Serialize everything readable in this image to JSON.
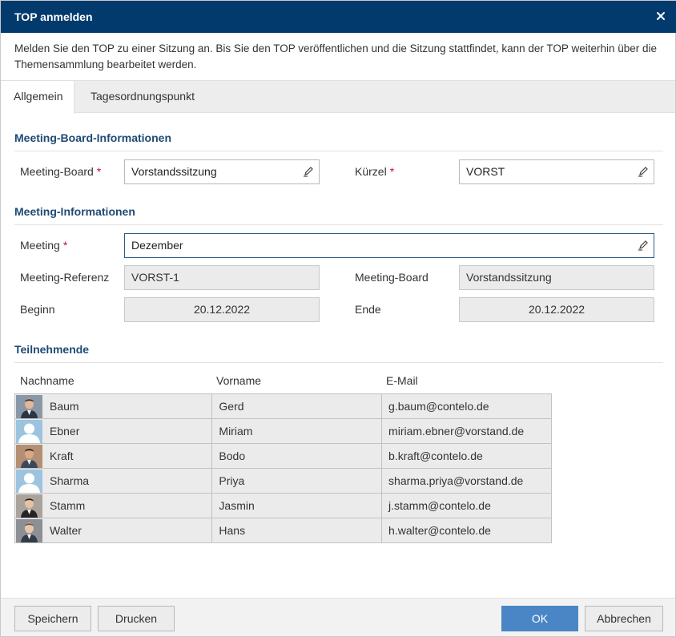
{
  "dialog": {
    "title": "TOP anmelden",
    "description": "Melden Sie den TOP zu einer Sitzung an. Bis Sie den TOP veröffentlichen und die Sitzung stattfindet, kann der TOP weiterhin über die Themensammlung bearbeitet werden."
  },
  "tabs": [
    {
      "label": "Allgemein",
      "active": true
    },
    {
      "label": "Tagesordnungspunkt",
      "active": false
    }
  ],
  "board_section": {
    "title": "Meeting-Board-Informationen",
    "board_label": "Meeting-Board",
    "board_value": "Vorstandssitzung",
    "short_label": "Kürzel",
    "short_value": "VORST",
    "required_mark": "*"
  },
  "meeting_section": {
    "title": "Meeting-Informationen",
    "meeting_label": "Meeting",
    "meeting_value": "Dezember",
    "reference_label": "Meeting-Referenz",
    "reference_value": "VORST-1",
    "board_label": "Meeting-Board",
    "board_value": "Vorstandssitzung",
    "start_label": "Beginn",
    "start_value": "20.12.2022",
    "end_label": "Ende",
    "end_value": "20.12.2022",
    "required_mark": "*"
  },
  "participants": {
    "title": "Teilnehmende",
    "columns": [
      "Nachname",
      "Vorname",
      "E-Mail"
    ],
    "rows": [
      {
        "last": "Baum",
        "first": "Gerd",
        "email": "g.baum@contelo.de",
        "avatar": "photo"
      },
      {
        "last": "Ebner",
        "first": "Miriam",
        "email": "miriam.ebner@vorstand.de",
        "avatar": "placeholder"
      },
      {
        "last": "Kraft",
        "first": "Bodo",
        "email": "b.kraft@contelo.de",
        "avatar": "photo"
      },
      {
        "last": "Sharma",
        "first": "Priya",
        "email": "sharma.priya@vorstand.de",
        "avatar": "placeholder"
      },
      {
        "last": "Stamm",
        "first": "Jasmin",
        "email": "j.stamm@contelo.de",
        "avatar": "photo"
      },
      {
        "last": "Walter",
        "first": "Hans",
        "email": "h.walter@contelo.de",
        "avatar": "photo"
      }
    ]
  },
  "footer": {
    "save": "Speichern",
    "print": "Drucken",
    "ok": "OK",
    "cancel": "Abbrechen"
  },
  "colors": {
    "titlebar": "#023a6e",
    "section_title": "#1f4a75",
    "required": "#c8102e",
    "primary_button": "#4a86c5"
  },
  "icons": {
    "close": "close-icon",
    "edit": "pencil-icon",
    "avatar_placeholder": "user-silhouette-icon",
    "avatar_photo": "user-photo-icon"
  }
}
